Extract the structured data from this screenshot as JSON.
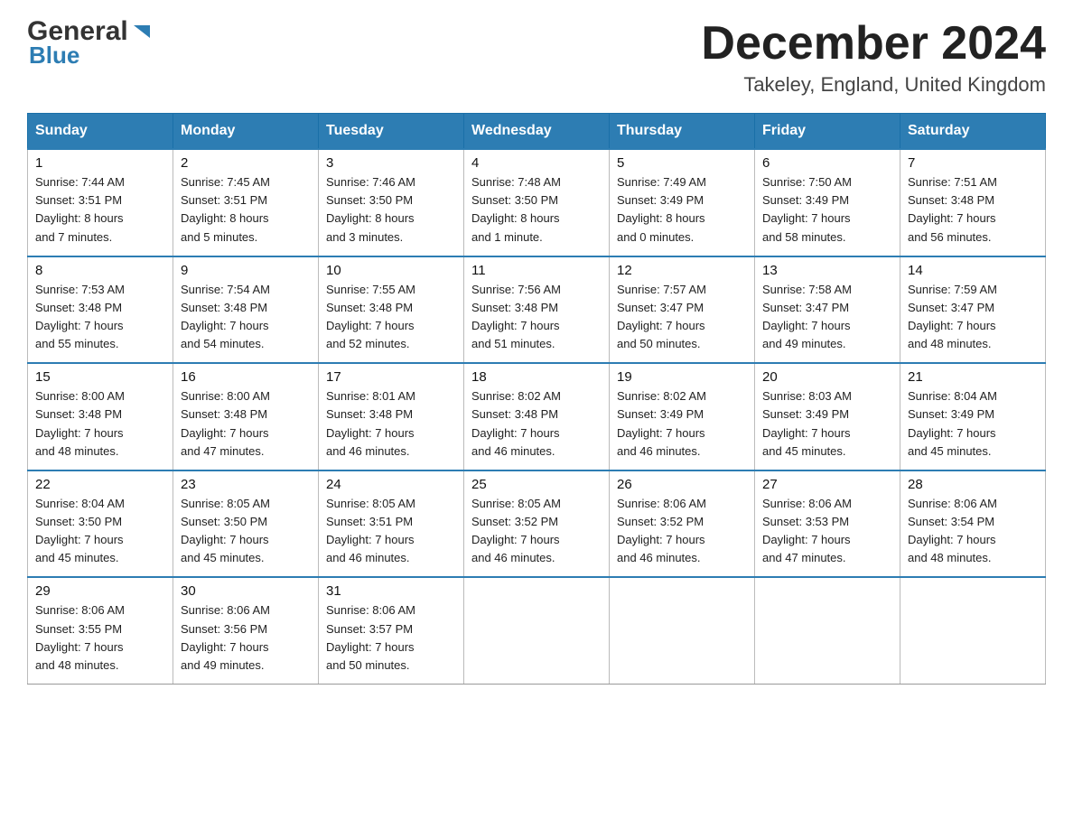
{
  "logo": {
    "general": "General",
    "blue": "Blue",
    "arrow": "▶"
  },
  "title": "December 2024",
  "subtitle": "Takeley, England, United Kingdom",
  "days_of_week": [
    "Sunday",
    "Monday",
    "Tuesday",
    "Wednesday",
    "Thursday",
    "Friday",
    "Saturday"
  ],
  "weeks": [
    [
      {
        "day": "1",
        "info": "Sunrise: 7:44 AM\nSunset: 3:51 PM\nDaylight: 8 hours\nand 7 minutes."
      },
      {
        "day": "2",
        "info": "Sunrise: 7:45 AM\nSunset: 3:51 PM\nDaylight: 8 hours\nand 5 minutes."
      },
      {
        "day": "3",
        "info": "Sunrise: 7:46 AM\nSunset: 3:50 PM\nDaylight: 8 hours\nand 3 minutes."
      },
      {
        "day": "4",
        "info": "Sunrise: 7:48 AM\nSunset: 3:50 PM\nDaylight: 8 hours\nand 1 minute."
      },
      {
        "day": "5",
        "info": "Sunrise: 7:49 AM\nSunset: 3:49 PM\nDaylight: 8 hours\nand 0 minutes."
      },
      {
        "day": "6",
        "info": "Sunrise: 7:50 AM\nSunset: 3:49 PM\nDaylight: 7 hours\nand 58 minutes."
      },
      {
        "day": "7",
        "info": "Sunrise: 7:51 AM\nSunset: 3:48 PM\nDaylight: 7 hours\nand 56 minutes."
      }
    ],
    [
      {
        "day": "8",
        "info": "Sunrise: 7:53 AM\nSunset: 3:48 PM\nDaylight: 7 hours\nand 55 minutes."
      },
      {
        "day": "9",
        "info": "Sunrise: 7:54 AM\nSunset: 3:48 PM\nDaylight: 7 hours\nand 54 minutes."
      },
      {
        "day": "10",
        "info": "Sunrise: 7:55 AM\nSunset: 3:48 PM\nDaylight: 7 hours\nand 52 minutes."
      },
      {
        "day": "11",
        "info": "Sunrise: 7:56 AM\nSunset: 3:48 PM\nDaylight: 7 hours\nand 51 minutes."
      },
      {
        "day": "12",
        "info": "Sunrise: 7:57 AM\nSunset: 3:47 PM\nDaylight: 7 hours\nand 50 minutes."
      },
      {
        "day": "13",
        "info": "Sunrise: 7:58 AM\nSunset: 3:47 PM\nDaylight: 7 hours\nand 49 minutes."
      },
      {
        "day": "14",
        "info": "Sunrise: 7:59 AM\nSunset: 3:47 PM\nDaylight: 7 hours\nand 48 minutes."
      }
    ],
    [
      {
        "day": "15",
        "info": "Sunrise: 8:00 AM\nSunset: 3:48 PM\nDaylight: 7 hours\nand 48 minutes."
      },
      {
        "day": "16",
        "info": "Sunrise: 8:00 AM\nSunset: 3:48 PM\nDaylight: 7 hours\nand 47 minutes."
      },
      {
        "day": "17",
        "info": "Sunrise: 8:01 AM\nSunset: 3:48 PM\nDaylight: 7 hours\nand 46 minutes."
      },
      {
        "day": "18",
        "info": "Sunrise: 8:02 AM\nSunset: 3:48 PM\nDaylight: 7 hours\nand 46 minutes."
      },
      {
        "day": "19",
        "info": "Sunrise: 8:02 AM\nSunset: 3:49 PM\nDaylight: 7 hours\nand 46 minutes."
      },
      {
        "day": "20",
        "info": "Sunrise: 8:03 AM\nSunset: 3:49 PM\nDaylight: 7 hours\nand 45 minutes."
      },
      {
        "day": "21",
        "info": "Sunrise: 8:04 AM\nSunset: 3:49 PM\nDaylight: 7 hours\nand 45 minutes."
      }
    ],
    [
      {
        "day": "22",
        "info": "Sunrise: 8:04 AM\nSunset: 3:50 PM\nDaylight: 7 hours\nand 45 minutes."
      },
      {
        "day": "23",
        "info": "Sunrise: 8:05 AM\nSunset: 3:50 PM\nDaylight: 7 hours\nand 45 minutes."
      },
      {
        "day": "24",
        "info": "Sunrise: 8:05 AM\nSunset: 3:51 PM\nDaylight: 7 hours\nand 46 minutes."
      },
      {
        "day": "25",
        "info": "Sunrise: 8:05 AM\nSunset: 3:52 PM\nDaylight: 7 hours\nand 46 minutes."
      },
      {
        "day": "26",
        "info": "Sunrise: 8:06 AM\nSunset: 3:52 PM\nDaylight: 7 hours\nand 46 minutes."
      },
      {
        "day": "27",
        "info": "Sunrise: 8:06 AM\nSunset: 3:53 PM\nDaylight: 7 hours\nand 47 minutes."
      },
      {
        "day": "28",
        "info": "Sunrise: 8:06 AM\nSunset: 3:54 PM\nDaylight: 7 hours\nand 48 minutes."
      }
    ],
    [
      {
        "day": "29",
        "info": "Sunrise: 8:06 AM\nSunset: 3:55 PM\nDaylight: 7 hours\nand 48 minutes."
      },
      {
        "day": "30",
        "info": "Sunrise: 8:06 AM\nSunset: 3:56 PM\nDaylight: 7 hours\nand 49 minutes."
      },
      {
        "day": "31",
        "info": "Sunrise: 8:06 AM\nSunset: 3:57 PM\nDaylight: 7 hours\nand 50 minutes."
      },
      {
        "day": "",
        "info": ""
      },
      {
        "day": "",
        "info": ""
      },
      {
        "day": "",
        "info": ""
      },
      {
        "day": "",
        "info": ""
      }
    ]
  ]
}
